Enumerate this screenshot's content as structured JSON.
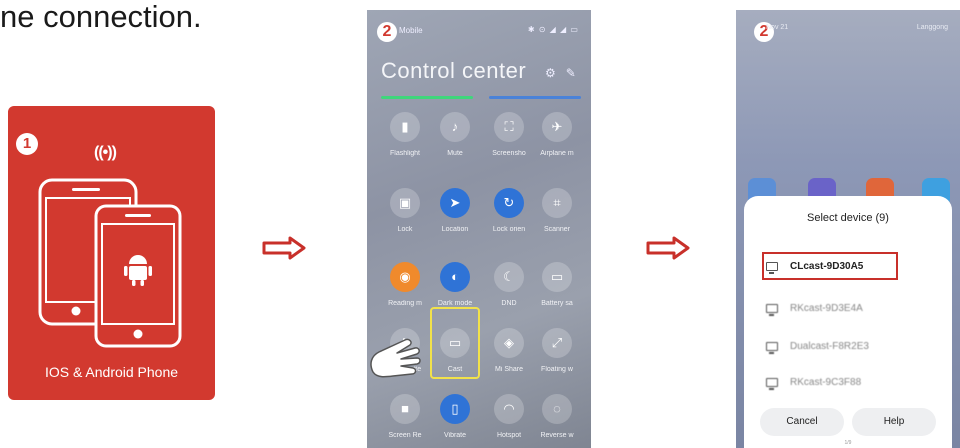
{
  "heading": "ne connection.",
  "card": {
    "step": "1",
    "caption": "IOS & Android Phone",
    "bg_color": "#d2392f"
  },
  "arrow_color": "#c8302a",
  "control_center": {
    "step": "2",
    "carrier": "Mobile",
    "status_icons": "✱ ⊙ ◢ ◢ ▭",
    "title": "Control center",
    "tiles": [
      {
        "label": "Flashlight",
        "icon": "flashlight-icon",
        "glyph": "▮"
      },
      {
        "label": "Mute",
        "icon": "bell-icon",
        "glyph": "♪"
      },
      {
        "label": "Screensho",
        "icon": "screenshot-icon",
        "glyph": "⛶"
      },
      {
        "label": "Airplane m",
        "icon": "airplane-icon",
        "glyph": "✈"
      },
      {
        "label": "Lock",
        "icon": "lock-icon",
        "glyph": "▣"
      },
      {
        "label": "Location",
        "icon": "location-icon",
        "glyph": "➤"
      },
      {
        "label": "Lock orien",
        "icon": "rotation-lock-icon",
        "glyph": "↻"
      },
      {
        "label": "Scanner",
        "icon": "scanner-icon",
        "glyph": "⌗"
      },
      {
        "label": "Reading m",
        "icon": "eye-icon",
        "glyph": "◉"
      },
      {
        "label": "Dark mode",
        "icon": "dark-mode-icon",
        "glyph": "◐"
      },
      {
        "label": "DND",
        "icon": "moon-icon",
        "glyph": "☾"
      },
      {
        "label": "Battery sa",
        "icon": "battery-icon",
        "glyph": "▭"
      },
      {
        "label": "Ultra batte",
        "icon": "ultra-battery-icon",
        "glyph": "ϟ"
      },
      {
        "label": "Cast",
        "icon": "cast-icon",
        "glyph": "▭"
      },
      {
        "label": "Mi Share",
        "icon": "mi-share-icon",
        "glyph": "◈"
      },
      {
        "label": "Floating w",
        "icon": "floating-window-icon",
        "glyph": "⤢"
      },
      {
        "label": "Screen Re",
        "icon": "screen-record-icon",
        "glyph": "■"
      },
      {
        "label": "Vibrate",
        "icon": "vibrate-icon",
        "glyph": "▯"
      },
      {
        "label": "Hotspot",
        "icon": "hotspot-icon",
        "glyph": "◠"
      },
      {
        "label": "Reverse w",
        "icon": "reverse-wireless-icon",
        "glyph": "◌"
      }
    ]
  },
  "select_device": {
    "step": "2",
    "top_left": "Nov 21",
    "top_right": "Langgong",
    "title": "Select device (9)",
    "devices": [
      "CLcast-9D30A5",
      "RKcast-9D3E4A",
      "Dualcast-F8R2E3",
      "RKcast-9C3F88"
    ],
    "cancel": "Cancel",
    "help": "Help",
    "pager": "1/9"
  }
}
